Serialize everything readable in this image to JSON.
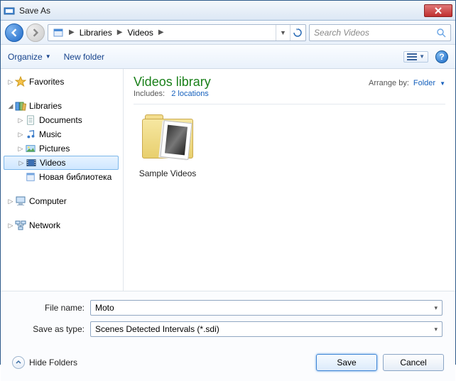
{
  "window": {
    "title": "Save As"
  },
  "nav": {
    "breadcrumb": [
      "Libraries",
      "Videos"
    ],
    "search_placeholder": "Search Videos"
  },
  "toolbar": {
    "organize": "Organize",
    "new_folder": "New folder"
  },
  "sidebar": {
    "favorites": "Favorites",
    "libraries": "Libraries",
    "libs": {
      "documents": "Documents",
      "music": "Music",
      "pictures": "Pictures",
      "videos": "Videos",
      "new_lib": "Новая библиотека"
    },
    "computer": "Computer",
    "network": "Network"
  },
  "content": {
    "title": "Videos library",
    "includes_label": "Includes:",
    "locations": "2 locations",
    "arrange_label": "Arrange by:",
    "arrange_value": "Folder",
    "items": [
      {
        "label": "Sample Videos"
      }
    ]
  },
  "form": {
    "filename_label": "File name:",
    "filename_value": "Moto",
    "type_label": "Save as type:",
    "type_value": "Scenes Detected Intervals (*.sdi)"
  },
  "footer": {
    "hide_folders": "Hide Folders",
    "save": "Save",
    "cancel": "Cancel"
  }
}
